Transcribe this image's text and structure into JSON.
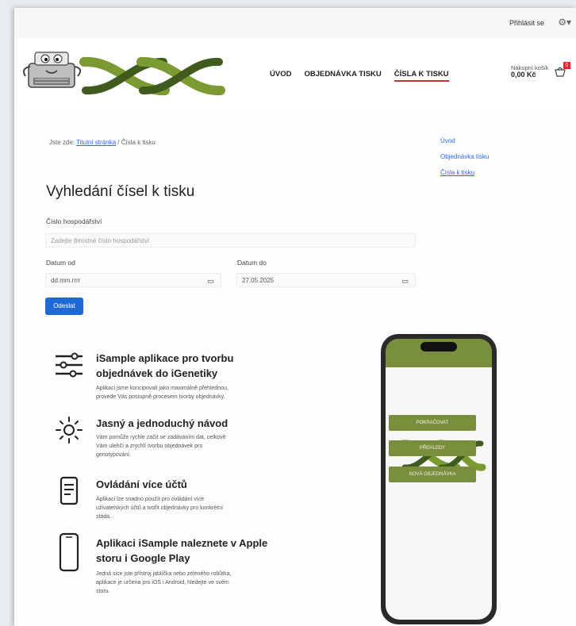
{
  "topbar": {
    "login_label": "Přihlásit se",
    "settings_icon": "gear-icon"
  },
  "header": {
    "logo_icon": "xx-logo-icon",
    "nav": [
      "ÚVOD",
      "OBJEDNÁVKA TISKU",
      "ČÍSLA K TISKU"
    ],
    "active_nav": "ČÍSLA K TISKU",
    "cart": {
      "label": "Nákupní košík",
      "amount": "0,00 Kč",
      "badge": "0"
    }
  },
  "breadcrumb": {
    "prefix": "Jste zde:",
    "home": "Titulní stránka",
    "separator": "/",
    "current": "Čísla k tisku"
  },
  "side_links": [
    "Úvod",
    "Objednávka tisku",
    "Čísla k tisku"
  ],
  "search": {
    "title": "Vyhledání čísel k tisku",
    "farm_label": "Číslo hospodářství",
    "farm_placeholder": "Zadejte 8místné číslo hospodářství",
    "date_from_label": "Datum od",
    "date_from_value": "dd.mm.rrrr",
    "date_to_label": "Datum do",
    "date_to_value": "27.05.2025",
    "submit_label": "Odeslat"
  },
  "features": [
    {
      "icon": "sliders-icon",
      "title_1": "iSample aplikace pro tvorbu",
      "title_2": "objednávek do iGenetiky",
      "desc_1": "Aplikaci jsme koncipovali jako maximálně přehlednou,",
      "desc_2": "provede Vás postupně procesem tvorby objednávky."
    },
    {
      "icon": "sun-icon",
      "title_1": "Jasný a jednoduchý návod",
      "desc_1": "Vám pomůže rychle začít se zadáváním dat, celkově",
      "desc_2": "Vám ulehčí a zrychlí tvorbu objednávek pro",
      "desc_3": "genotypování."
    },
    {
      "icon": "document-icon",
      "title_1": "Ovládání více účtů",
      "desc_1": "Aplikaci lze snadno použít pro ovládání více",
      "desc_2": "uživatelských účtů a tvořit objednávky pro konkrétní",
      "desc_3": "stáda."
    },
    {
      "icon": "smartphone-icon",
      "title_1": "Aplikaci iSample naleznete v Apple",
      "title_2": "storu i Google Play",
      "desc_1": "Jedná sice jste přístroj jablíčka nebo zeleného robůtka,",
      "desc_2": "aplikace je určena pro iOS i Android, hledejte ve svém",
      "desc_3": "storu."
    }
  ],
  "phone": {
    "buttons": [
      "POKRAČOVAT",
      "PŘEHLEDY",
      "NOVÁ OBJEDNÁVKA"
    ],
    "brand_color": "#7a8f3e"
  },
  "colors": {
    "accent": "#1e6ad2",
    "brand_green": "#6b8a2e",
    "nav_underline": "#c0392b"
  }
}
